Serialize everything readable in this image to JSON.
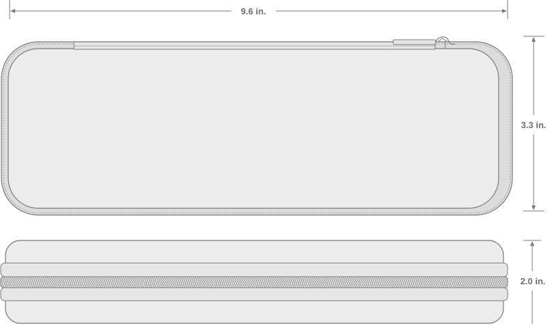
{
  "dimensions": {
    "width_label": "9.6 in.",
    "height_label": "3.3 in.",
    "depth_label": "2.0 in."
  },
  "colors": {
    "line": "#7a7a7a",
    "case_fill": "#ececec",
    "zipper_fill": "#dcdcdc",
    "background": "#ffffff"
  }
}
